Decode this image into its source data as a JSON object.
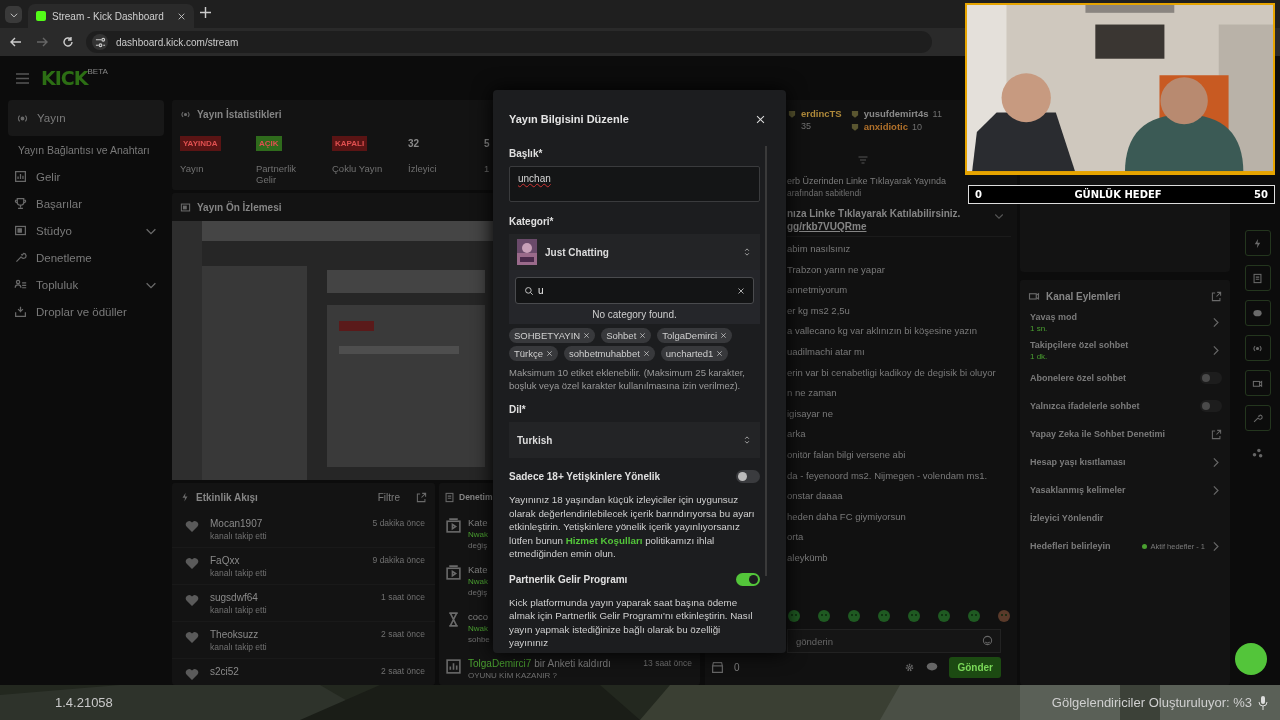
{
  "browser": {
    "tab_title": "Stream - Kick Dashboard",
    "url": "dashboard.kick.com/stream"
  },
  "sidebar": {
    "logo": "KICK",
    "logo_badge": "BETA",
    "items": [
      {
        "label": "Yayın",
        "kind": "link",
        "selected": true,
        "children": [
          {
            "label": "Yayın Bağlantısı ve Anahtarı",
            "selected": false
          }
        ]
      },
      {
        "label": "Gelir",
        "kind": "link",
        "selected": false
      },
      {
        "label": "Başarılar",
        "kind": "link",
        "selected": false
      },
      {
        "label": "Stüdyo",
        "kind": "group",
        "selected": false,
        "expanded": false
      },
      {
        "label": "Denetleme",
        "kind": "link",
        "selected": false
      },
      {
        "label": "Topluluk",
        "kind": "group",
        "selected": false,
        "expanded": false
      },
      {
        "label": "Droplar ve ödüller",
        "kind": "link",
        "selected": false
      }
    ]
  },
  "stats": {
    "title": "Yayın İstatistikleri",
    "items": [
      {
        "kind": "badge",
        "value": "YAYINDA",
        "label": "Yayın",
        "color": "#5a1414"
      },
      {
        "kind": "badge",
        "value": "AÇIK",
        "label": "Partnerlik Gelir",
        "color": "#2f6b1c"
      },
      {
        "kind": "badge",
        "value": "KAPALI",
        "label": "Çoklu Yayın",
        "color": "#5a1414"
      },
      {
        "kind": "number",
        "value": "32",
        "label": "İzleyici"
      },
      {
        "kind": "number",
        "value": "5",
        "label": "1"
      }
    ]
  },
  "preview": {
    "title": "Yayın Ön İzlemesi",
    "kind": "picture"
  },
  "activity": {
    "title": "Etkinlik Akışı",
    "filter": "Filtre",
    "items": [
      {
        "name": "Mocan1907",
        "action": "kanalı takip etti",
        "time": "5 dakika önce"
      },
      {
        "name": "FaQxx",
        "action": "kanalı takip etti",
        "time": "9 dakika önce"
      },
      {
        "name": "sugsdwf64",
        "action": "kanalı takip etti",
        "time": "1 saat önce"
      },
      {
        "name": "Theoksuzz",
        "action": "kanalı takip etti",
        "time": "2 saat önce"
      },
      {
        "name": "s2ci52",
        "time": "2 saat önce"
      }
    ]
  },
  "moderation": {
    "title": "Denetim",
    "items": [
      {
        "kind": "category",
        "title": "Kate",
        "user": "Nwak",
        "detail": "değiş"
      },
      {
        "kind": "category",
        "title": "Kate",
        "user": "Nwak",
        "detail": "değiş"
      },
      {
        "kind": "timer",
        "title": "coco",
        "user": "Nwak",
        "detail": "sohbe"
      },
      {
        "kind": "poll",
        "user": "TolgaDemirci7",
        "title": "bir Anketi kaldırdı",
        "time": "13 saat önce",
        "detail": "OYUNU KİM KAZANIR ?"
      }
    ]
  },
  "chat": {
    "top_chatters": [
      {
        "name": "erdincTS",
        "count": "35",
        "color": "#b08a3a"
      },
      {
        "name": "yusufdemirt4s",
        "count": "11",
        "color": "#8a8a8a"
      },
      {
        "name": "anxidiotic",
        "count": "10",
        "color": "#b0702a"
      }
    ],
    "pinned": {
      "header": "erb Üzerinden Linke Tıklayarak Yayında",
      "by": "arafından sabitlendi",
      "text": "nıza Linke Tıklayarak Katılabilirsiniz.",
      "link": "gg/rkb7VUQRme"
    },
    "messages": [
      {
        "text": "abim nasılsınız"
      },
      {
        "text": "Trabzon yarın ne yapar"
      },
      {
        "text": "annetmiyorum"
      },
      {
        "text": "er kg ms2 2,5u"
      },
      {
        "text": "a vallecano kg var aklınızın bi köşesine yazın"
      },
      {
        "text": "uadilmachi atar mı"
      },
      {
        "text": "erin var bi cenabetligi kadikoy de degisik bi oluyor"
      },
      {
        "text": "n ne zaman"
      },
      {
        "text": "igisayar ne"
      },
      {
        "text": "arka"
      },
      {
        "text": "onitör falan bilgi versene abi"
      },
      {
        "text": "da - feyenoord ms2. Nijmegen - volendam ms1."
      },
      {
        "text": "onstar daaaa"
      },
      {
        "text": "heden daha FC giymiyorsun"
      },
      {
        "text": "orta"
      },
      {
        "text": "aleykümb"
      }
    ],
    "input": {
      "placeholder": "gönderin"
    },
    "points": "0",
    "send": "Gönder"
  },
  "channel_actions": {
    "title": "Kanal Eylemleri",
    "items": [
      {
        "kind": "submenu",
        "label": "Yavaş mod",
        "value": "1 sn."
      },
      {
        "kind": "submenu",
        "label": "Takipçilere özel sohbet",
        "value": "1 dk."
      },
      {
        "kind": "toggle",
        "label": "Abonelere özel sohbet",
        "on": false
      },
      {
        "kind": "toggle",
        "label": "Yalnızca ifadelerle sohbet",
        "on": false
      },
      {
        "kind": "external",
        "label": "Yapay Zeka ile Sohbet Denetimi"
      },
      {
        "kind": "submenu",
        "label": "Hesap yaşı kısıtlaması"
      },
      {
        "kind": "submenu",
        "label": "Yasaklanmış kelimeler"
      },
      {
        "kind": "plain",
        "label": "İzleyici Yönlendir"
      },
      {
        "kind": "submenu",
        "label": "Hedefleri belirleyin",
        "status": "Aktif hedefler - 1"
      }
    ]
  },
  "modal": {
    "title": "Yayın Bilgisini Düzenle",
    "title_label": "Başlık*",
    "title_value": "unchan",
    "category_label": "Kategori*",
    "category": "Just Chatting",
    "category_search": {
      "value": "u",
      "empty": "No category found."
    },
    "tags": [
      {
        "label": "SOHBETYAYIN"
      },
      {
        "label": "Sohbet"
      },
      {
        "label": "TolgaDemirci"
      },
      {
        "label": "Türkçe"
      },
      {
        "label": "sohbetmuhabbet"
      },
      {
        "label": "uncharted1"
      }
    ],
    "tags_hint": "Maksimum 10 etiket eklenebilir. (Maksimum 25 karakter, boşluk veya özel karakter kullanılmasına izin verilmez).",
    "language_label": "Dil*",
    "language": "Turkish",
    "adult": {
      "label": "Sadece 18+ Yetişkinlere Yönelik",
      "on": false,
      "text_before": "Yayınınız 18 yaşından küçük izleyiciler için uygunsuz olarak değerlendirilebilecek içerik barındırıyorsa bu ayarı etkinleştirin. Yetişkinlere yönelik içerik yayınlıyorsanız lütfen bunun",
      "link": "Hizmet Koşulları",
      "text_after": "politikamızı ihlal etmediğinden emin olun."
    },
    "partner": {
      "label": "Partnerlik Gelir Programı",
      "on": true,
      "text": "Kick platformunda yayın yaparak saat başına ödeme almak için Partnerlik Gelir Programı'nı etkinleştirin. Nasıl yayın yapmak istediğinize bağlı olarak bu özelliği yayınınız"
    }
  },
  "overlay": {
    "goal": {
      "current": "0",
      "label": "GÜNLÜK HEDEF",
      "target": "50"
    },
    "version": "1.4.21058",
    "loading": "Gölgelendiriciler Oluşturuluyor: %3"
  }
}
